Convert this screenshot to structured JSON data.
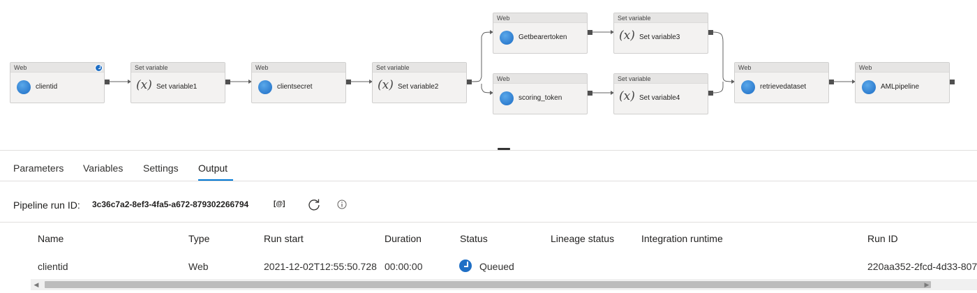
{
  "pipeline": {
    "nodes": [
      {
        "type": "Web",
        "label": "clientid",
        "icon": "web-globe-icon",
        "badge": "queued-clock-icon"
      },
      {
        "type": "Set variable",
        "label": "Set variable1",
        "icon": "variable-x-icon"
      },
      {
        "type": "Web",
        "label": "clientsecret",
        "icon": "web-globe-icon"
      },
      {
        "type": "Set variable",
        "label": "Set variable2",
        "icon": "variable-x-icon"
      },
      {
        "type": "Web",
        "label": "Getbearertoken",
        "icon": "web-globe-icon"
      },
      {
        "type": "Set variable",
        "label": "Set variable3",
        "icon": "variable-x-icon"
      },
      {
        "type": "Web",
        "label": "scoring_token",
        "icon": "web-globe-icon"
      },
      {
        "type": "Set variable",
        "label": "Set variable4",
        "icon": "variable-x-icon"
      },
      {
        "type": "Web",
        "label": "retrievedataset",
        "icon": "web-globe-icon"
      },
      {
        "type": "Web",
        "label": "AMLpipeline",
        "icon": "web-globe-icon"
      }
    ]
  },
  "tabs": [
    {
      "label": "Parameters"
    },
    {
      "label": "Variables"
    },
    {
      "label": "Settings"
    },
    {
      "label": "Output",
      "active": true
    }
  ],
  "run": {
    "label": "Pipeline run ID:",
    "id": "3c36c7a2-8ef3-4fa5-a672-879302266794",
    "copy_icon": "[@]"
  },
  "table": {
    "columns": [
      "Name",
      "Type",
      "Run start",
      "Duration",
      "Status",
      "Lineage status",
      "Integration runtime",
      "Run ID"
    ],
    "rows": [
      {
        "name": "clientid",
        "type": "Web",
        "run_start": "2021-12-02T12:55:50.728",
        "duration": "00:00:00",
        "status": "Queued",
        "lineage_status": "",
        "integration_runtime": "",
        "run_id": "220aa352-2fcd-4d33-807"
      }
    ]
  },
  "colors": {
    "accent": "#0078d4",
    "status_queued": "#1f6fc5"
  }
}
